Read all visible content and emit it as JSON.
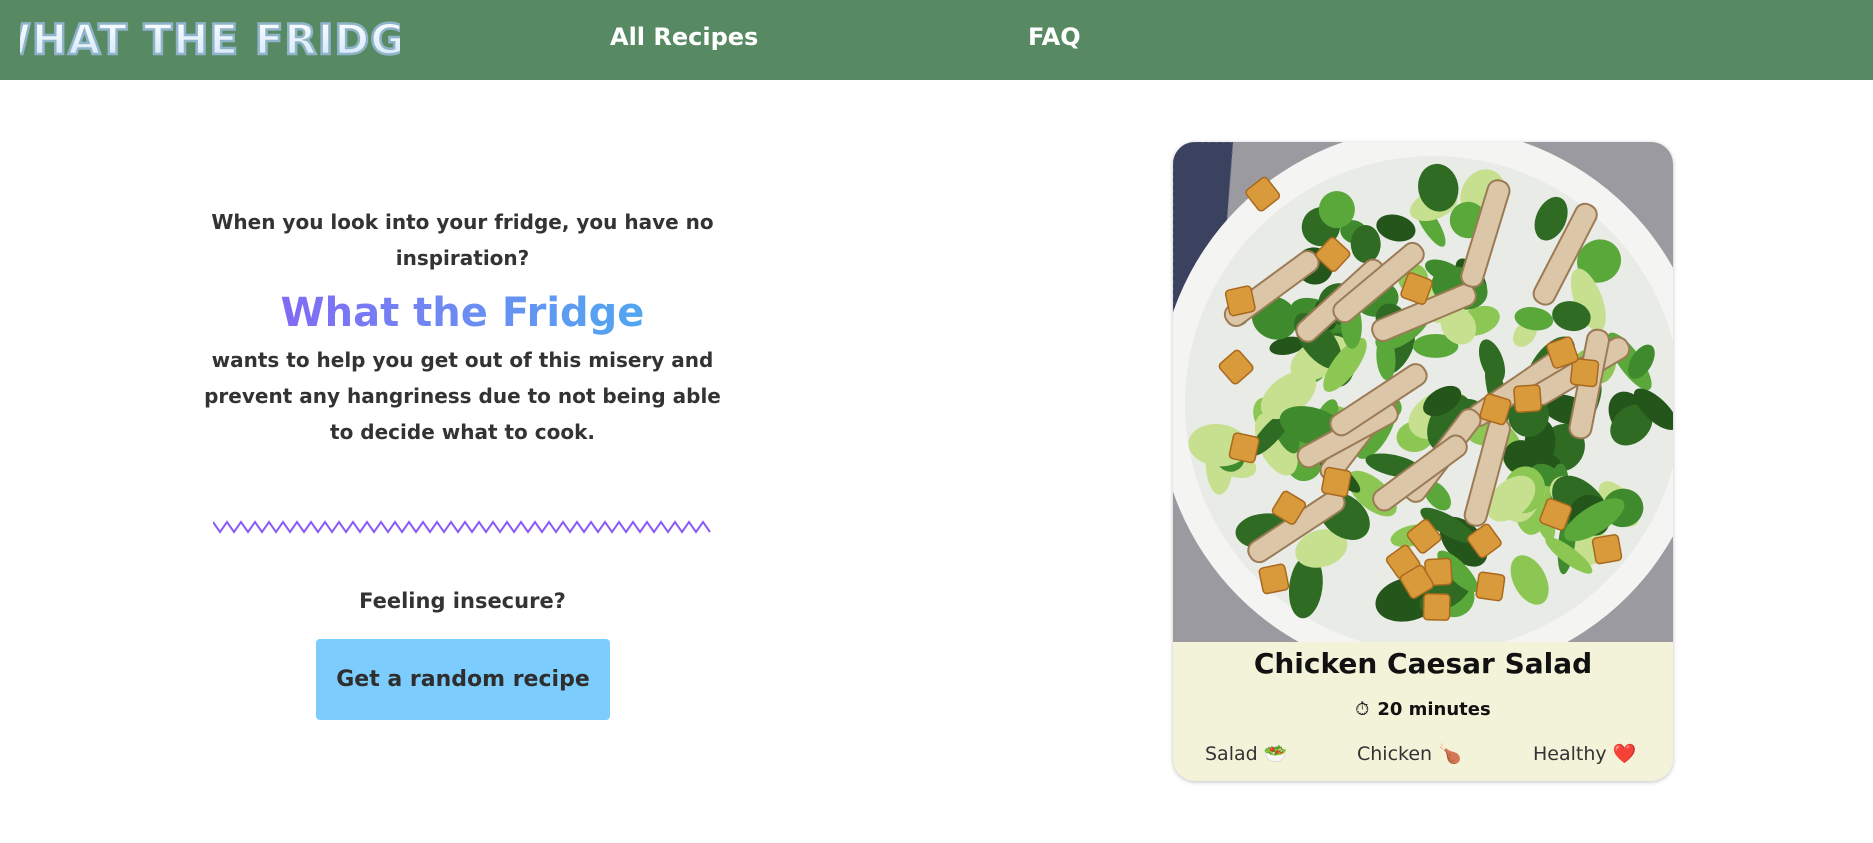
{
  "header": {
    "logo_text": "WHAT THE FRIDGE",
    "nav": [
      {
        "label": "All Recipes"
      },
      {
        "label": "FAQ"
      }
    ],
    "background_color": "#578a63"
  },
  "intro": {
    "question": "When you look into your fridge, you have no inspiration?",
    "brand_name": "What the Fridge",
    "body": "wants to help you get out of this misery and prevent any hangriness due to not being able to decide what to cook.",
    "brand_gradient": [
      "#8a5cf5",
      "#44b3f0"
    ]
  },
  "random": {
    "prompt": "Feeling insecure?",
    "button_label": "Get a random recipe",
    "button_color": "#7ccdfd"
  },
  "recipe_card": {
    "title": "Chicken Caesar Salad",
    "time_icon": "stopwatch-icon",
    "time": "20 minutes",
    "tags": [
      {
        "label": "Salad",
        "emoji": "🥗"
      },
      {
        "label": "Chicken",
        "emoji": "🍗"
      },
      {
        "label": "Healthy",
        "emoji": "❤️"
      }
    ],
    "image": "chicken-caesar-salad-photo",
    "card_color": "#f3f3da"
  }
}
